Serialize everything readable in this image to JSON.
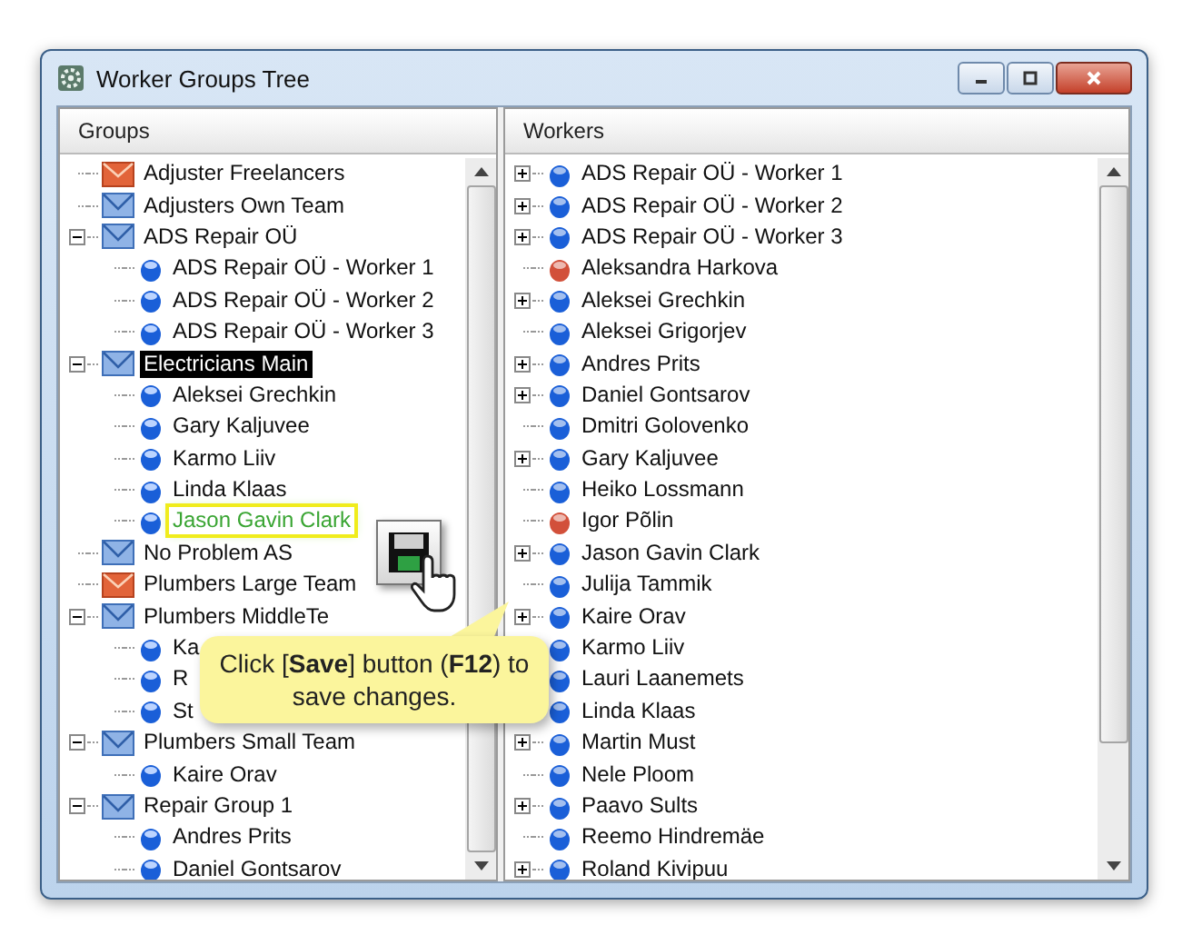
{
  "window": {
    "title": "Worker Groups Tree"
  },
  "groups": {
    "header": "Groups",
    "items": [
      {
        "kind": "group-alt",
        "label": "Adjuster Freelancers",
        "selected": false
      },
      {
        "kind": "group",
        "label": "Adjusters Own Team",
        "selected": false
      },
      {
        "kind": "group",
        "label": "ADS Repair OÜ",
        "selected": false,
        "children": [
          {
            "kind": "worker",
            "label": "ADS Repair OÜ - Worker 1",
            "selected": false
          },
          {
            "kind": "worker",
            "label": "ADS Repair OÜ - Worker 2",
            "selected": false
          },
          {
            "kind": "worker",
            "label": "ADS Repair OÜ - Worker 3",
            "selected": false
          }
        ]
      },
      {
        "kind": "group",
        "label": "Electricians Main",
        "selected": true,
        "children": [
          {
            "kind": "worker",
            "label": "Aleksei Grechkin",
            "selected": false
          },
          {
            "kind": "worker",
            "label": "Gary Kaljuvee",
            "selected": false
          },
          {
            "kind": "worker",
            "label": "Karmo Liiv",
            "selected": false
          },
          {
            "kind": "worker",
            "label": "Linda Klaas",
            "selected": false
          },
          {
            "kind": "worker",
            "label": "Jason Gavin Clark",
            "selected": false,
            "highlighted": true
          }
        ]
      },
      {
        "kind": "group",
        "label": "No Problem AS",
        "selected": false
      },
      {
        "kind": "group-alt",
        "label": "Plumbers Large Team",
        "selected": false
      },
      {
        "kind": "group",
        "label": "Plumbers MiddleTe",
        "selected": false,
        "children": [
          {
            "kind": "worker",
            "label": "Ka",
            "selected": false
          },
          {
            "kind": "worker",
            "label": "R",
            "selected": false
          },
          {
            "kind": "worker",
            "label": "St",
            "selected": false
          }
        ]
      },
      {
        "kind": "group",
        "label": "Plumbers Small Team",
        "selected": false,
        "children": [
          {
            "kind": "worker",
            "label": "Kaire Orav",
            "selected": false
          }
        ]
      },
      {
        "kind": "group",
        "label": "Repair Group 1",
        "selected": false,
        "children": [
          {
            "kind": "worker",
            "label": "Andres Prits",
            "selected": false
          },
          {
            "kind": "worker",
            "label": "Daniel Gontsarov",
            "selected": false
          }
        ]
      }
    ]
  },
  "workers": {
    "header": "Workers",
    "items": [
      {
        "label": "ADS Repair OÜ - Worker 1",
        "expandable": true,
        "color": "#1a5fd8"
      },
      {
        "label": "ADS Repair OÜ - Worker 2",
        "expandable": true,
        "color": "#1a5fd8"
      },
      {
        "label": "ADS Repair OÜ - Worker 3",
        "expandable": true,
        "color": "#1a5fd8"
      },
      {
        "label": "Aleksandra Harkova",
        "expandable": false,
        "color": "#d2503a"
      },
      {
        "label": "Aleksei Grechkin",
        "expandable": true,
        "color": "#1a5fd8"
      },
      {
        "label": "Aleksei Grigorjev",
        "expandable": false,
        "color": "#1a5fd8"
      },
      {
        "label": "Andres Prits",
        "expandable": true,
        "color": "#1a5fd8"
      },
      {
        "label": "Daniel Gontsarov",
        "expandable": true,
        "color": "#1a5fd8"
      },
      {
        "label": "Dmitri Golovenko",
        "expandable": false,
        "color": "#1a5fd8"
      },
      {
        "label": "Gary Kaljuvee",
        "expandable": true,
        "color": "#1a5fd8"
      },
      {
        "label": "Heiko Lossmann",
        "expandable": false,
        "color": "#1a5fd8"
      },
      {
        "label": "Igor Põlin",
        "expandable": false,
        "color": "#d2503a"
      },
      {
        "label": "Jason Gavin Clark",
        "expandable": true,
        "color": "#1a5fd8"
      },
      {
        "label": "Julija Tammik",
        "expandable": false,
        "color": "#1a5fd8"
      },
      {
        "label": "Kaire Orav",
        "expandable": true,
        "color": "#1a5fd8"
      },
      {
        "label": "Karmo Liiv",
        "expandable": false,
        "color": "#1a5fd8"
      },
      {
        "label": "Lauri Laanemets",
        "expandable": false,
        "color": "#1a5fd8"
      },
      {
        "label": "Linda Klaas",
        "expandable": false,
        "color": "#1a5fd8"
      },
      {
        "label": "Martin Must",
        "expandable": true,
        "color": "#1a5fd8"
      },
      {
        "label": "Nele Ploom",
        "expandable": false,
        "color": "#1a5fd8"
      },
      {
        "label": "Paavo Sults",
        "expandable": true,
        "color": "#1a5fd8"
      },
      {
        "label": "Reemo Hindremäe",
        "expandable": false,
        "color": "#1a5fd8"
      },
      {
        "label": "Roland Kivipuu",
        "expandable": true,
        "color": "#1a5fd8"
      }
    ]
  },
  "callout": {
    "text": "Click [**Save**] button (**F12**) to save changes."
  }
}
